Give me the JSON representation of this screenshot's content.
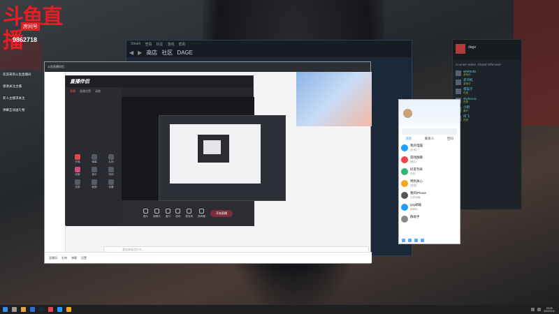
{
  "stream_logo": {
    "name": "斗鱼直播",
    "badge": "房间号",
    "room_number": "9862718"
  },
  "overlay_messages": [
    "欢迎来到斗鱼直播间",
    "感谢关注主播",
    "新人主播求关注",
    "弹幕互动送礼物"
  ],
  "steam": {
    "menu": [
      "Steam",
      "查看",
      "好友",
      "游戏",
      "帮助"
    ],
    "nav": [
      "商店",
      "社区",
      "DAGE"
    ]
  },
  "live_app": {
    "title": "斗鱼直播伴侣",
    "chat_placeholder": "我也来说点什么...",
    "bottom_items": [
      "直播间",
      "礼物",
      "弹幕",
      "设置"
    ]
  },
  "inner_app": {
    "logo": "直播伴侣",
    "tabs": [
      "直播",
      "直播设置",
      "录制"
    ],
    "grid": [
      "开播",
      "弹幕",
      "礼物",
      "房管",
      "音乐",
      "特效",
      "连麦",
      "截图",
      "设置"
    ],
    "tools": [
      "图片",
      "摄像头",
      "窗口",
      "游戏",
      "麦克风",
      "扬声器"
    ],
    "go_live": "开始直播"
  },
  "chat_app": {
    "tabs": [
      "消息",
      "联系人",
      "空间"
    ],
    "items": [
      {
        "name": "我的电脑",
        "msg": "[文件]",
        "color": "#1c9fff"
      },
      {
        "name": "游戏群聊",
        "msg": "[图片]",
        "color": "#e44"
      },
      {
        "name": "好友列表",
        "msg": "在线",
        "color": "#2bb673"
      },
      {
        "name": "特别关心",
        "msg": "[语音]",
        "color": "#f5a623"
      },
      {
        "name": "我的iPhone",
        "msg": "文件传输",
        "color": "#555"
      },
      {
        "name": "QQ邮箱",
        "msg": "新邮件",
        "color": "#1c9fff"
      },
      {
        "name": "群助手",
        "msg": "…",
        "color": "#888"
      }
    ]
  },
  "friends": {
    "user": "dage",
    "section": "Counter-Strike: Global Offensive",
    "items": [
      {
        "name": "WWWJD",
        "status": "游戏中"
      },
      {
        "name": "老司机",
        "status": "游戏中"
      },
      {
        "name": "夜猫子",
        "status": "在线"
      },
      {
        "name": "skyheroic",
        "status": "在线"
      },
      {
        "name": "小明",
        "status": "离开"
      },
      {
        "name": "阿飞",
        "status": "在线"
      }
    ]
  },
  "taskbar": {
    "time": "23:05",
    "date": "2022/2/11"
  }
}
